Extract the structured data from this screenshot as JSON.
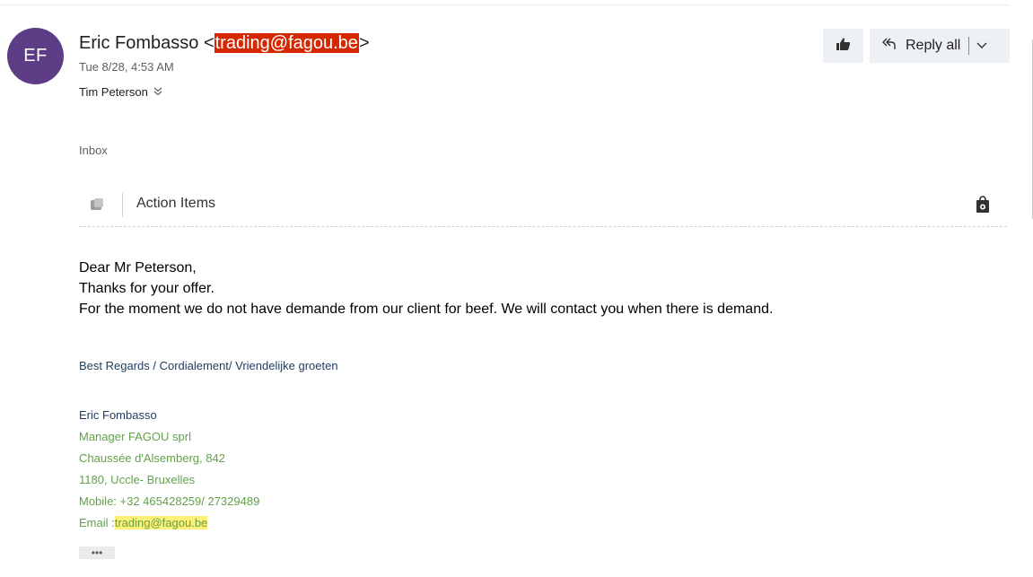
{
  "message": {
    "avatar_initials": "EF",
    "sender_name": "Eric Fombasso",
    "sender_email": "trading@fagou.be",
    "date": "Tue 8/28, 4:53 AM",
    "to": "Tim Peterson",
    "folder": "Inbox"
  },
  "toolbar": {
    "reply_all_label": "Reply all"
  },
  "action_bar": {
    "label": "Action Items"
  },
  "body": {
    "lines": [
      "Dear Mr Peterson,",
      "Thanks for your offer.",
      "For the moment we do not have demande from our client for beef. We will contact you when there is demand."
    ],
    "regards": "Best Regards / Cordialement/ Vriendelijke groeten"
  },
  "signature": {
    "name": "Eric Fombasso",
    "title": "Manager FAGOU sprl",
    "address1": "Chaussée d'Alsemberg, 842",
    "address2": "1180, Uccle- Bruxelles",
    "mobile": "Mobile: +32 465428259/ 27329489",
    "email_prefix": "Email :",
    "email": "trading@fagou.be"
  },
  "more_label": "•••",
  "colors": {
    "avatar_bg": "#5c3d86",
    "email_highlight_red": "#d62800",
    "button_bg": "#edf1f5",
    "signature_green": "#63a14b",
    "signature_navy": "#1f3a5f",
    "email_highlight_yellow": "#fff176"
  },
  "icons": {
    "like": "thumbs-up-icon",
    "reply_all": "reply-all-icon",
    "dropdown": "chevron-down-icon",
    "expand_recipients": "double-chevron-down-icon",
    "action_items": "action-items-icon",
    "store": "store-bag-icon"
  }
}
